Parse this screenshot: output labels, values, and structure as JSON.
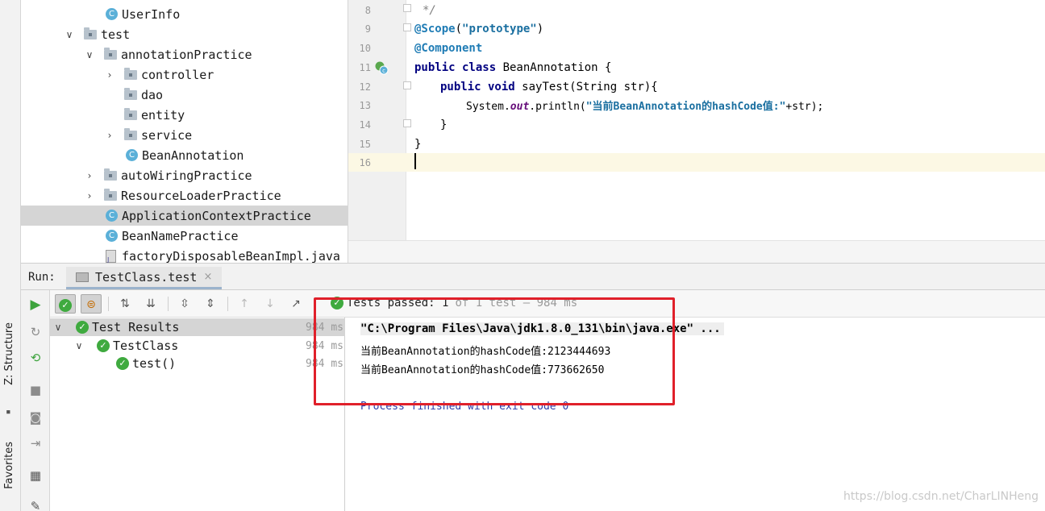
{
  "side_tabs": {
    "structure": "Z: Structure",
    "favorites": "Favorites"
  },
  "project_tree": [
    {
      "label": "UserInfo",
      "icon": "class-icon",
      "arrow": ""
    },
    {
      "label": "test",
      "icon": "folder-icon",
      "arrow": "∨"
    },
    {
      "label": "annotationPractice",
      "icon": "folder-icon",
      "arrow": "∨"
    },
    {
      "label": "controller",
      "icon": "folder-icon",
      "arrow": "›"
    },
    {
      "label": "dao",
      "icon": "folder-icon",
      "arrow": ""
    },
    {
      "label": "entity",
      "icon": "folder-icon",
      "arrow": ""
    },
    {
      "label": "service",
      "icon": "folder-icon",
      "arrow": "›"
    },
    {
      "label": "BeanAnnotation",
      "icon": "class-icon",
      "arrow": ""
    },
    {
      "label": "autoWiringPractice",
      "icon": "folder-icon",
      "arrow": "›"
    },
    {
      "label": "ResourceLoaderPractice",
      "icon": "folder-icon",
      "arrow": "›"
    },
    {
      "label": "ApplicationContextPractice",
      "icon": "class-icon",
      "arrow": "",
      "selected": true
    },
    {
      "label": "BeanNamePractice",
      "icon": "class-icon",
      "arrow": ""
    },
    {
      "label": "factoryDisposableBeanImpl.java",
      "icon": "java-file-icon",
      "arrow": ""
    }
  ],
  "editor": {
    "lines": [
      {
        "no": "8"
      },
      {
        "no": "9"
      },
      {
        "no": "10"
      },
      {
        "no": "11"
      },
      {
        "no": "12"
      },
      {
        "no": "13"
      },
      {
        "no": "14"
      },
      {
        "no": "15"
      },
      {
        "no": "16"
      }
    ],
    "code": {
      "l8": "*/",
      "l9_ann": "@Scope",
      "l9_str": "\"prototype\"",
      "l10_ann": "@Component",
      "l11_kw": "public class ",
      "l11_rest": "BeanAnnotation {",
      "l12_kw": "public void ",
      "l12_rest": "sayTest(String str){",
      "l13_a": "System.",
      "l13_fld": "out",
      "l13_b": ".println(",
      "l13_str": "\"当前BeanAnnotation的hashCode值:\"",
      "l13_c": "+str);",
      "l14": "}",
      "l15": "}"
    }
  },
  "run_panel": {
    "label": "Run:",
    "tab": "TestClass.test",
    "status": "Tests passed: 1",
    "status_sub": "of 1 test – 984 ms"
  },
  "test_results": [
    {
      "label": "Test Results",
      "time": "984 ms"
    },
    {
      "label": "TestClass",
      "time": "984 ms"
    },
    {
      "label": "test()",
      "time": "984 ms"
    }
  ],
  "console": {
    "cmd": "\"C:\\Program Files\\Java\\jdk1.8.0_131\\bin\\java.exe\" ...",
    "out1": "当前BeanAnnotation的hashCode值:2123444693",
    "out2": "当前BeanAnnotation的hashCode值:773662650",
    "exit": "Process finished with exit code 0"
  },
  "watermark": "https://blog.csdn.net/CharLINHeng",
  "colors": {
    "highlight": "#e0202a",
    "pass_green": "#3faa3f",
    "selection": "#d5d5d5"
  }
}
